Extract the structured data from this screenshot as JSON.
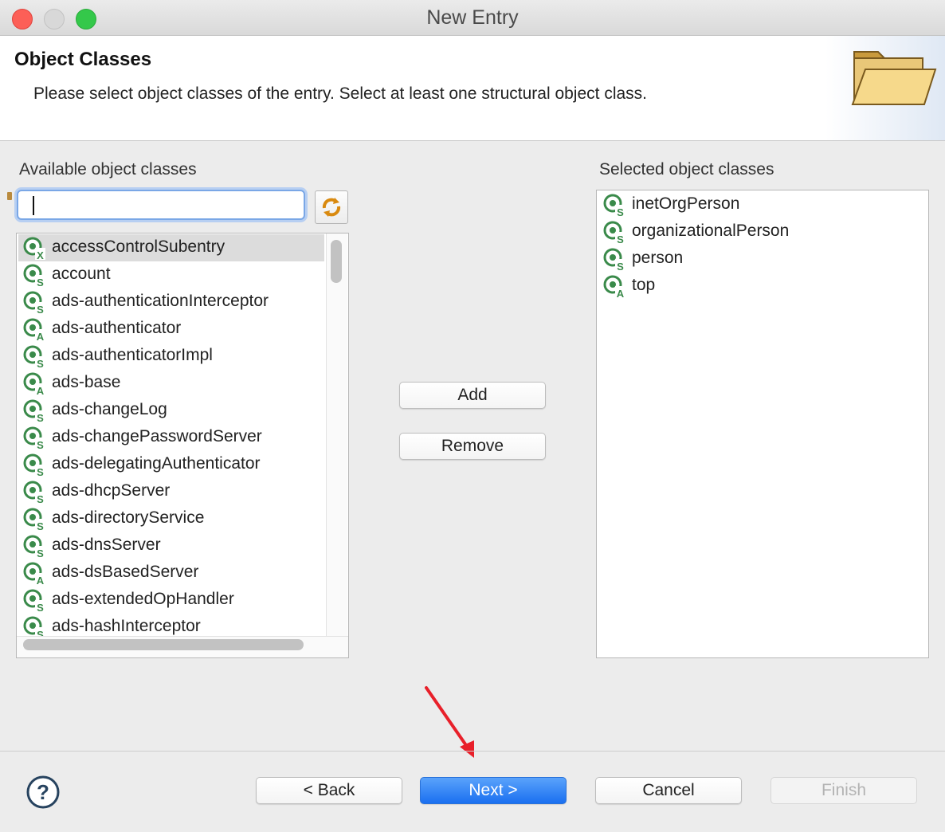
{
  "window": {
    "title": "New Entry"
  },
  "header": {
    "title": "Object Classes",
    "description": "Please select object classes of the entry. Select at least one structural object class."
  },
  "available": {
    "label": "Available object classes",
    "filter_value": "",
    "items": [
      {
        "label": "accessControlSubentry",
        "kind": "X",
        "selected": true
      },
      {
        "label": "account",
        "kind": "S"
      },
      {
        "label": "ads-authenticationInterceptor",
        "kind": "S"
      },
      {
        "label": "ads-authenticator",
        "kind": "A"
      },
      {
        "label": "ads-authenticatorImpl",
        "kind": "S"
      },
      {
        "label": "ads-base",
        "kind": "A"
      },
      {
        "label": "ads-changeLog",
        "kind": "S"
      },
      {
        "label": "ads-changePasswordServer",
        "kind": "S"
      },
      {
        "label": "ads-delegatingAuthenticator",
        "kind": "S"
      },
      {
        "label": "ads-dhcpServer",
        "kind": "S"
      },
      {
        "label": "ads-directoryService",
        "kind": "S"
      },
      {
        "label": "ads-dnsServer",
        "kind": "S"
      },
      {
        "label": "ads-dsBasedServer",
        "kind": "A"
      },
      {
        "label": "ads-extendedOpHandler",
        "kind": "S"
      },
      {
        "label": "ads-hashInterceptor",
        "kind": "S"
      }
    ]
  },
  "selected": {
    "label": "Selected object classes",
    "items": [
      {
        "label": "inetOrgPerson",
        "kind": "S"
      },
      {
        "label": "organizationalPerson",
        "kind": "S"
      },
      {
        "label": "person",
        "kind": "S"
      },
      {
        "label": "top",
        "kind": "A"
      }
    ]
  },
  "actions": {
    "add": "Add",
    "remove": "Remove"
  },
  "footer": {
    "help": "?",
    "back": "< Back",
    "next": "Next >",
    "cancel": "Cancel",
    "finish": "Finish"
  },
  "colors": {
    "icon_green": "#3a8a4a",
    "primary_button": "#1a6ff0",
    "annotation_arrow": "#e8202a"
  }
}
